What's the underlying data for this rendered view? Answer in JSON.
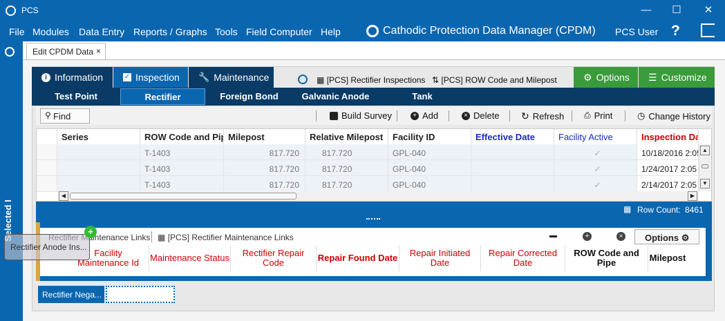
{
  "window": {
    "title": "PCS"
  },
  "menu": [
    "File",
    "Modules",
    "Data Entry",
    "Reports / Graphs",
    "Tools",
    "Field Computer",
    "Help"
  ],
  "app": {
    "title": "Cathodic Protection Data Manager (CPDM)",
    "user": "PCS User",
    "help": "?"
  },
  "sidebar": {
    "label": "Selected I"
  },
  "doc_tab": {
    "label": "Edit CPDM Data",
    "close": "×"
  },
  "main_tabs": {
    "information": "Information",
    "inspection": "Inspection",
    "maintenance": "Maintenance"
  },
  "links": {
    "inspections": "[PCS] Rectifier Inspections",
    "row": "[PCS] ROW Code and Milepost"
  },
  "right_buttons": {
    "options": "Options",
    "customize": "Customize"
  },
  "sub_tabs": [
    "Test Point",
    "Rectifier",
    "Foreign Bond",
    "Galvanic Anode",
    "Tank"
  ],
  "toolbar": {
    "find": "Find",
    "build": "Build Survey",
    "add": "Add",
    "delete": "Delete",
    "refresh": "Refresh",
    "print": "Print",
    "history": "Change History"
  },
  "grid": {
    "columns": [
      "Series",
      "ROW Code and Pipe",
      "Milepost",
      "Relative Milepost",
      "Facility ID",
      "Effective Date",
      "Facility Active",
      "Inspection Dat"
    ],
    "rows": [
      [
        "",
        "T-1403",
        "817.720",
        "817.720",
        "GPL-040",
        "",
        "✓",
        "10/18/2016 2:05"
      ],
      [
        "",
        "T-1403",
        "817.720",
        "817.720",
        "GPL-040",
        "",
        "✓",
        "1/24/2017 2:05"
      ],
      [
        "",
        "T-1403",
        "817.720",
        "817.720",
        "GPL-040",
        "",
        "✓",
        "2/14/2017 2:05"
      ]
    ],
    "row_count_label": "Row Count:",
    "row_count": "8461"
  },
  "maint": {
    "title": "Rectifier Maintenance Links",
    "link": "[PCS] Rectifier Maintenance Links",
    "options": "Options",
    "columns": [
      "Facility Maintenance Id",
      "Maintenance Status",
      "Rectifier Repair Code",
      "Repair Found Date",
      "Repair Initiated Date",
      "Repair Corrected Date",
      "ROW Code and Pipe",
      "Milepost"
    ]
  },
  "bottom_tab": "Rectifier Nega...",
  "drag_label": "Rectifier Anode Ins..."
}
